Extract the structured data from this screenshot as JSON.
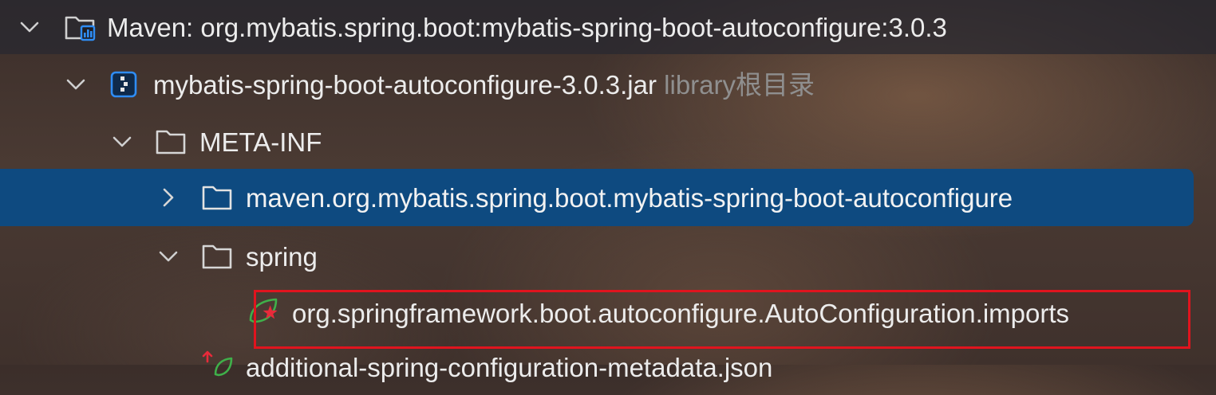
{
  "tree": {
    "rows": [
      {
        "label": "Maven: org.mybatis.spring.boot:mybatis-spring-boot-autoconfigure:3.0.3",
        "expanded": true,
        "icon": "maven-library-icon"
      },
      {
        "label": "mybatis-spring-boot-autoconfigure-3.0.3.jar",
        "sublabel": "library根目录",
        "expanded": true,
        "icon": "jar-archive-icon"
      },
      {
        "label": "META-INF",
        "expanded": true,
        "icon": "folder-icon"
      },
      {
        "label": "maven.org.mybatis.spring.boot.mybatis-spring-boot-autoconfigure",
        "expanded": false,
        "selected": true,
        "icon": "folder-icon"
      },
      {
        "label": "spring",
        "expanded": true,
        "icon": "folder-icon"
      },
      {
        "label": "org.springframework.boot.autoconfigure.AutoConfiguration.imports",
        "icon": "spring-imports-file-icon",
        "highlighted": true
      },
      {
        "label": "additional-spring-configuration-metadata.json",
        "icon": "spring-metadata-file-icon"
      }
    ]
  },
  "colors": {
    "selection": "#0e4a80",
    "highlight_border": "#e0141e",
    "secondary_text": "#8f8f8f"
  }
}
